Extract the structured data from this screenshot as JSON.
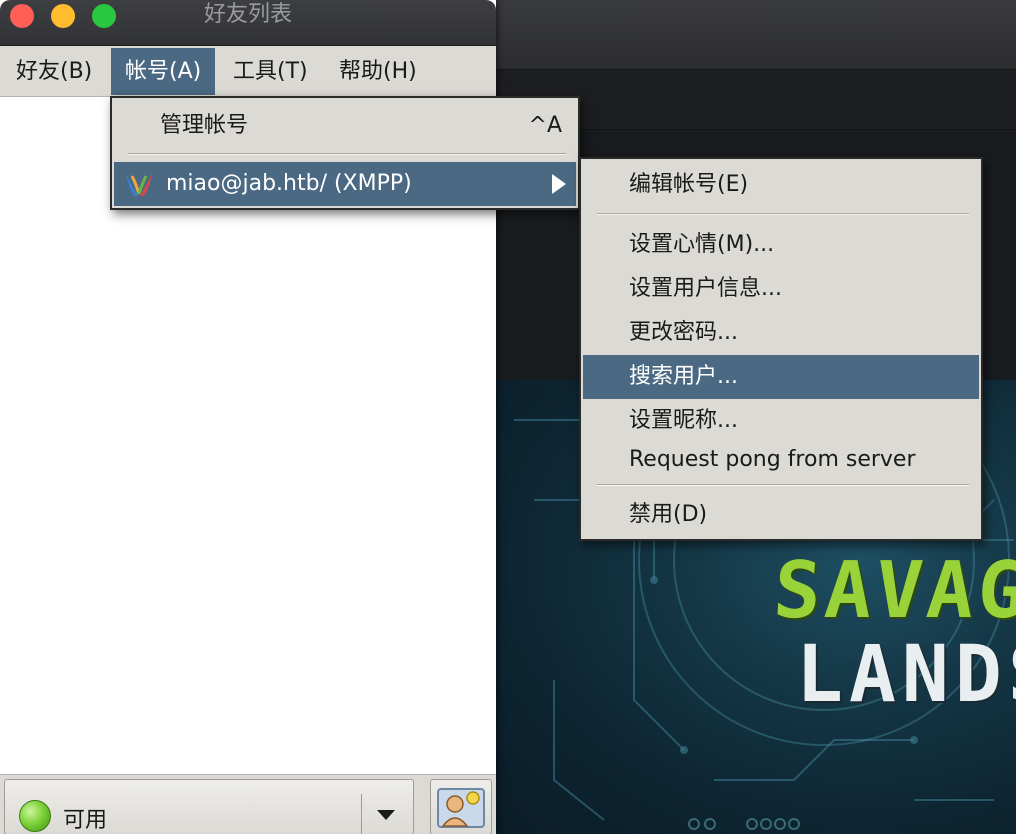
{
  "window": {
    "title": "好友列表"
  },
  "menubar": {
    "buddies": "好友(B)",
    "accounts": "帐号(A)",
    "tools": "工具(T)",
    "help": "帮助(H)"
  },
  "accounts_menu": {
    "manage_label": "管理帐号",
    "manage_accel": "^A",
    "account_label": "miao@jab.htb/ (XMPP)"
  },
  "account_submenu": {
    "items": [
      "编辑帐号(E)",
      "设置心情(M)...",
      "设置用户信息...",
      "更改密码...",
      "搜索用户...",
      "设置昵称...",
      "Request pong from server",
      "禁用(D)"
    ],
    "highlighted": "搜索用户..."
  },
  "statusbar": {
    "status": "可用",
    "status_color": "#6cc52e"
  },
  "background_app": {
    "logo_line1": "SAVAGE",
    "logo_line2": "LANDS"
  },
  "colors": {
    "highlight": "#4b6983",
    "menu_bg": "#dcdad5"
  }
}
